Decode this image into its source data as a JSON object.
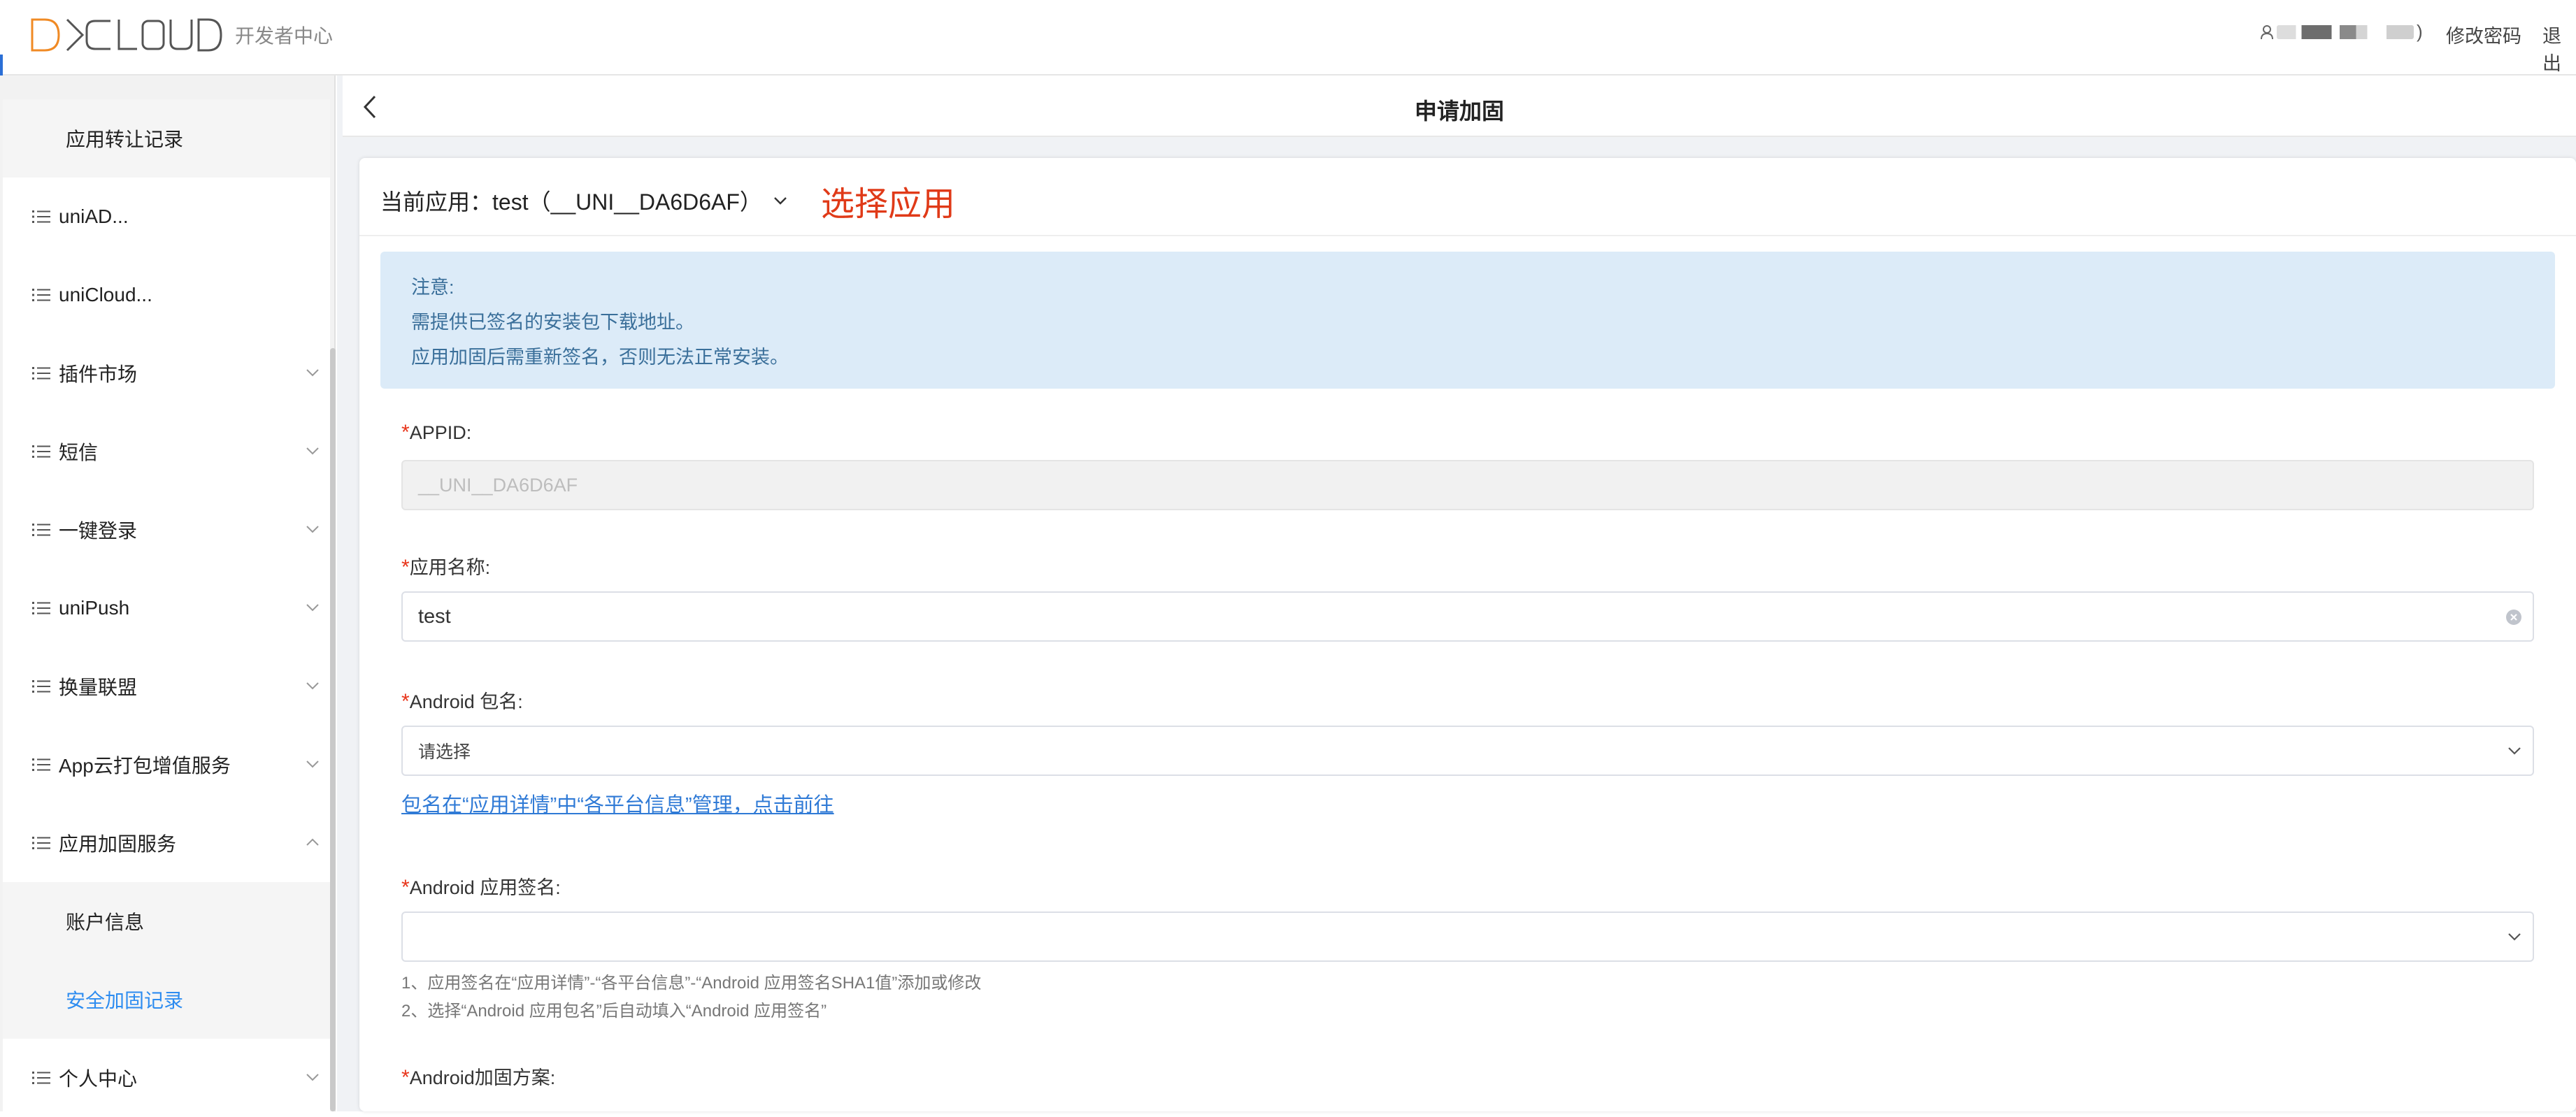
{
  "header": {
    "logo_text": "DCLOUD",
    "subtitle": "开发者中心",
    "user_suffix": ")",
    "change_password": "修改密码",
    "logout": "退出"
  },
  "sidebar": {
    "items": [
      {
        "label": "应用转让记录"
      },
      {
        "label": "uniAD..."
      },
      {
        "label": "uniCloud..."
      },
      {
        "label": "插件市场"
      },
      {
        "label": "短信"
      },
      {
        "label": "一键登录"
      },
      {
        "label": "uniPush"
      },
      {
        "label": "换量联盟"
      },
      {
        "label": "App云打包增值服务"
      },
      {
        "label": "应用加固服务"
      },
      {
        "label": "账户信息"
      },
      {
        "label": "安全加固记录"
      },
      {
        "label": "个人中心"
      }
    ]
  },
  "page": {
    "title": "申请加固",
    "current_app": "当前应用：test（__UNI__DA6D6AF）",
    "select_app": "选择应用"
  },
  "notice": {
    "title": "注意:",
    "line1": "需提供已签名的安装包下载地址。",
    "line2": "应用加固后需重新签名，否则无法正常安装。"
  },
  "form": {
    "required_mark": "*",
    "appid_label": "APPID:",
    "appid_value": "__UNI__DA6D6AF",
    "name_label": "应用名称:",
    "name_value": "test",
    "pkg_label": "Android 包名:",
    "pkg_placeholder": "请选择",
    "pkg_link": "包名在“应用详情”中“各平台信息”管理，点击前往",
    "sign_label": "Android 应用签名:",
    "sign_hint1": "1、应用签名在“应用详情”-“各平台信息”-“Android 应用签名SHA1值”添加或修改",
    "sign_hint2": "2、选择“Android 应用包名”后自动填入“Android 应用签名”",
    "scheme_label": "Android加固方案:"
  },
  "colors": {
    "accent": "#2d8cf0",
    "select_app": "#e03a18",
    "required": "#e8361c",
    "notice_bg": "#dcebf8"
  }
}
